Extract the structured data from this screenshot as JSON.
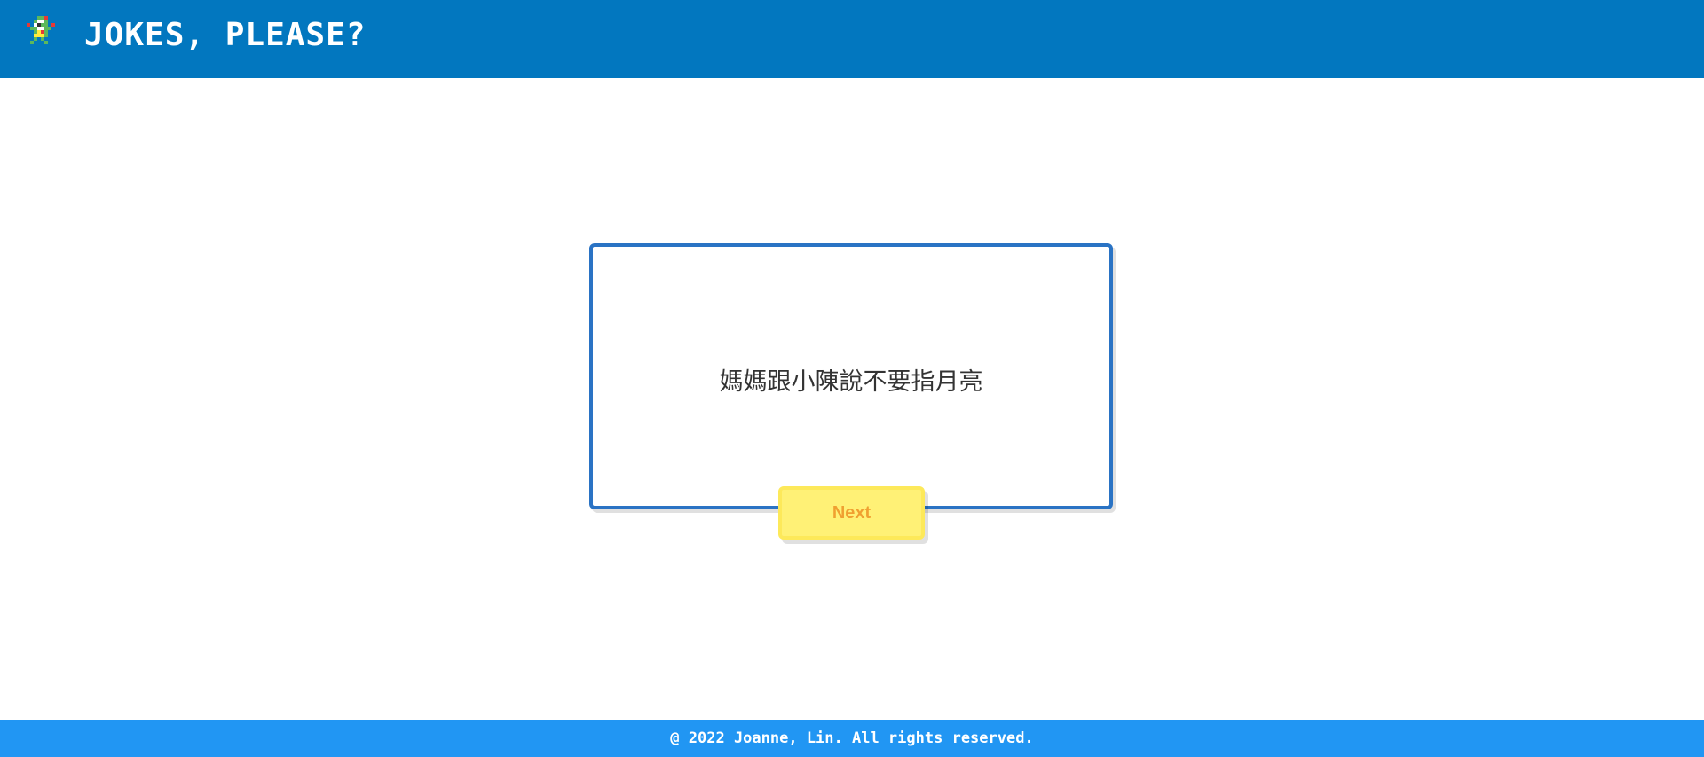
{
  "header": {
    "title": "JOKES, PLEASE?",
    "logo_icon": "pixel-character-icon",
    "background": "#0277bf"
  },
  "main": {
    "joke_text": "媽媽跟小陳說不要指月亮",
    "next_label": "Next",
    "card_border_color": "#2a73c4",
    "button_color": "#fff176",
    "button_text_color": "#f0a030"
  },
  "footer": {
    "copyright": "@ 2022 Joanne, Lin. All rights reserved.",
    "background": "#2196f3"
  }
}
